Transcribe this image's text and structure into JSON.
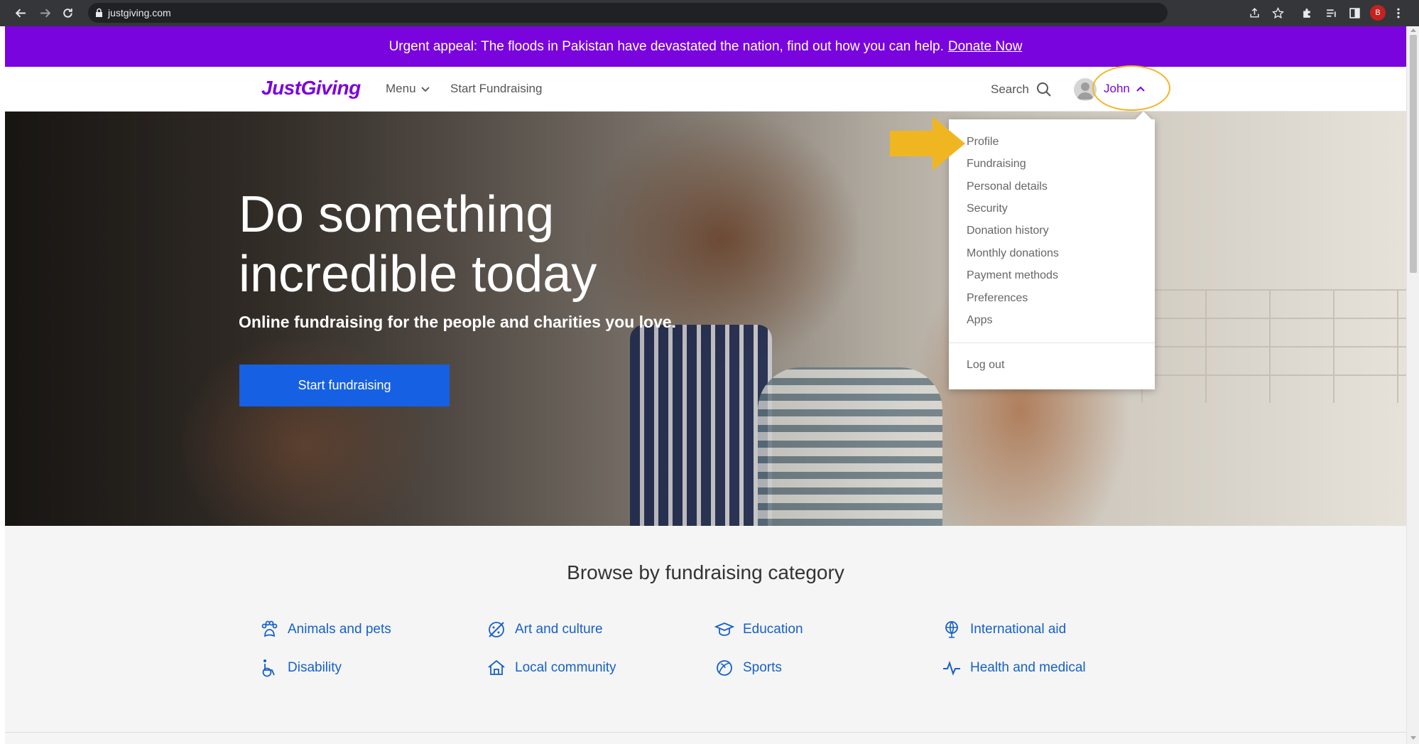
{
  "browser": {
    "url": "justgiving.com",
    "profile_initial": "B"
  },
  "banner": {
    "text": "Urgent appeal: The floods in Pakistan have devastated the nation, find out how you can help.",
    "link": "Donate Now",
    "color": "#7a04dd"
  },
  "header": {
    "logo": "JustGiving",
    "menu_label": "Menu",
    "start_label": "Start Fundraising",
    "search_label": "Search",
    "user_name": "John"
  },
  "hero": {
    "title_line1": "Do something",
    "title_line2": "incredible today",
    "subtitle": "Online fundraising for the people and charities you love.",
    "cta": "Start fundraising",
    "cta_color": "#1660e3"
  },
  "user_menu": {
    "items": [
      "Profile",
      "Fundraising",
      "Personal details",
      "Security",
      "Donation history",
      "Monthly donations",
      "Payment methods",
      "Preferences",
      "Apps"
    ],
    "logout": "Log out"
  },
  "categories": {
    "title": "Browse by fundraising category",
    "items": [
      {
        "label": "Animals and pets",
        "icon": "paw-icon"
      },
      {
        "label": "Art and culture",
        "icon": "palette-icon"
      },
      {
        "label": "Education",
        "icon": "graduation-cap-icon"
      },
      {
        "label": "International aid",
        "icon": "globe-icon"
      },
      {
        "label": "Disability",
        "icon": "wheelchair-icon"
      },
      {
        "label": "Local community",
        "icon": "house-icon"
      },
      {
        "label": "Sports",
        "icon": "ball-icon"
      },
      {
        "label": "Health and medical",
        "icon": "heartbeat-icon"
      }
    ],
    "accent": "#1660c9"
  },
  "annotation": {
    "highlight_color": "#f0b622"
  }
}
